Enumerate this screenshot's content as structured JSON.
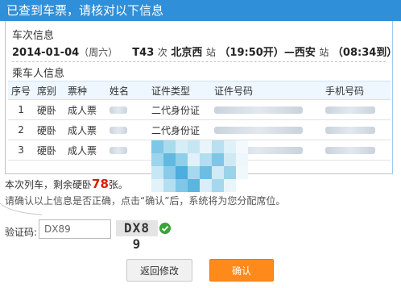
{
  "window": {
    "title": "已查到车票，请核对以下信息"
  },
  "train_info": {
    "section_title": "车次信息",
    "date": "2014-01-04",
    "weekday": "（周六）",
    "train_no": "T43",
    "train_suffix": "次",
    "from_station": "北京西",
    "station_suffix_from": "站",
    "depart_time": "（19:50开）",
    "dash": "—",
    "to_station": "西安",
    "station_suffix_to": "站",
    "arrive_time": "（08:34到）"
  },
  "passengers": {
    "section_title": "乘车人信息",
    "columns": [
      "序号",
      "席别",
      "票种",
      "姓名",
      "证件类型",
      "证件号码",
      "手机号码"
    ],
    "rows": [
      {
        "index": "1",
        "seat": "硬卧",
        "ticket_type": "成人票",
        "id_type": "二代身份证"
      },
      {
        "index": "2",
        "seat": "硬卧",
        "ticket_type": "成人票",
        "id_type": "二代身份证"
      },
      {
        "index": "3",
        "seat": "硬卧",
        "ticket_type": "成人票",
        "id_type": "二代身份证"
      }
    ]
  },
  "remaining": {
    "prefix": "本次列车，剩余硬卧",
    "count": "78",
    "suffix": "张。"
  },
  "hint": "请确认以上信息是否正确，点击“确认”后，系统将为您分配席位。",
  "captcha": {
    "label": "验证码:",
    "input_value": "DX89",
    "image_text": "DX8 9"
  },
  "buttons": {
    "back": "返回修改",
    "confirm": "确认"
  },
  "colors": {
    "title_bar": "#2f8fd8",
    "confirm": "#ff8a1c",
    "remaining_count": "#d81e06"
  }
}
